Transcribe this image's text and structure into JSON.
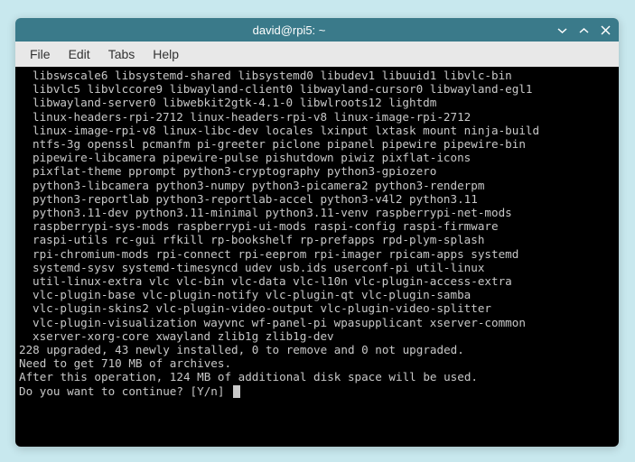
{
  "window": {
    "title": "david@rpi5: ~"
  },
  "menu": {
    "file": "File",
    "edit": "Edit",
    "tabs": "Tabs",
    "help": "Help"
  },
  "terminal": {
    "packages": [
      "libswscale6 libsystemd-shared libsystemd0 libudev1 libuuid1 libvlc-bin",
      "libvlc5 libvlccore9 libwayland-client0 libwayland-cursor0 libwayland-egl1",
      "libwayland-server0 libwebkit2gtk-4.1-0 libwlroots12 lightdm",
      "linux-headers-rpi-2712 linux-headers-rpi-v8 linux-image-rpi-2712",
      "linux-image-rpi-v8 linux-libc-dev locales lxinput lxtask mount ninja-build",
      "ntfs-3g openssl pcmanfm pi-greeter piclone pipanel pipewire pipewire-bin",
      "pipewire-libcamera pipewire-pulse pishutdown piwiz pixflat-icons",
      "pixflat-theme pprompt python3-cryptography python3-gpiozero",
      "python3-libcamera python3-numpy python3-picamera2 python3-renderpm",
      "python3-reportlab python3-reportlab-accel python3-v4l2 python3.11",
      "python3.11-dev python3.11-minimal python3.11-venv raspberrypi-net-mods",
      "raspberrypi-sys-mods raspberrypi-ui-mods raspi-config raspi-firmware",
      "raspi-utils rc-gui rfkill rp-bookshelf rp-prefapps rpd-plym-splash",
      "rpi-chromium-mods rpi-connect rpi-eeprom rpi-imager rpicam-apps systemd",
      "systemd-sysv systemd-timesyncd udev usb.ids userconf-pi util-linux",
      "util-linux-extra vlc vlc-bin vlc-data vlc-l10n vlc-plugin-access-extra",
      "vlc-plugin-base vlc-plugin-notify vlc-plugin-qt vlc-plugin-samba",
      "vlc-plugin-skins2 vlc-plugin-video-output vlc-plugin-video-splitter",
      "vlc-plugin-visualization wayvnc wf-panel-pi wpasupplicant xserver-common",
      "xserver-xorg-core xwayland zlib1g zlib1g-dev"
    ],
    "summary": "228 upgraded, 43 newly installed, 0 to remove and 0 not upgraded.",
    "download": "Need to get 710 MB of archives.",
    "disk": "After this operation, 124 MB of additional disk space will be used.",
    "prompt": "Do you want to continue? [Y/n] "
  }
}
